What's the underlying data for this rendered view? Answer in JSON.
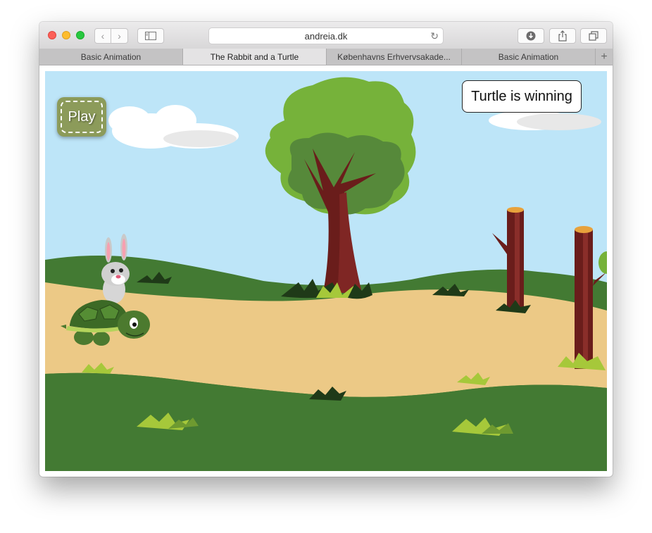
{
  "browser": {
    "url": "andreia.dk",
    "tabs": [
      {
        "label": "Basic Animation",
        "active": false
      },
      {
        "label": "The Rabbit and a Turtle",
        "active": true
      },
      {
        "label": "Københavns Erhvervsakade...",
        "active": false
      },
      {
        "label": "Basic Animation",
        "active": false
      }
    ]
  },
  "game": {
    "play_label": "Play",
    "status_text": "Turtle is winning",
    "colors": {
      "sky": "#bde5f8",
      "grass": "#437a33",
      "path": "#ecc986",
      "play_button": "#8c9b5a"
    }
  }
}
